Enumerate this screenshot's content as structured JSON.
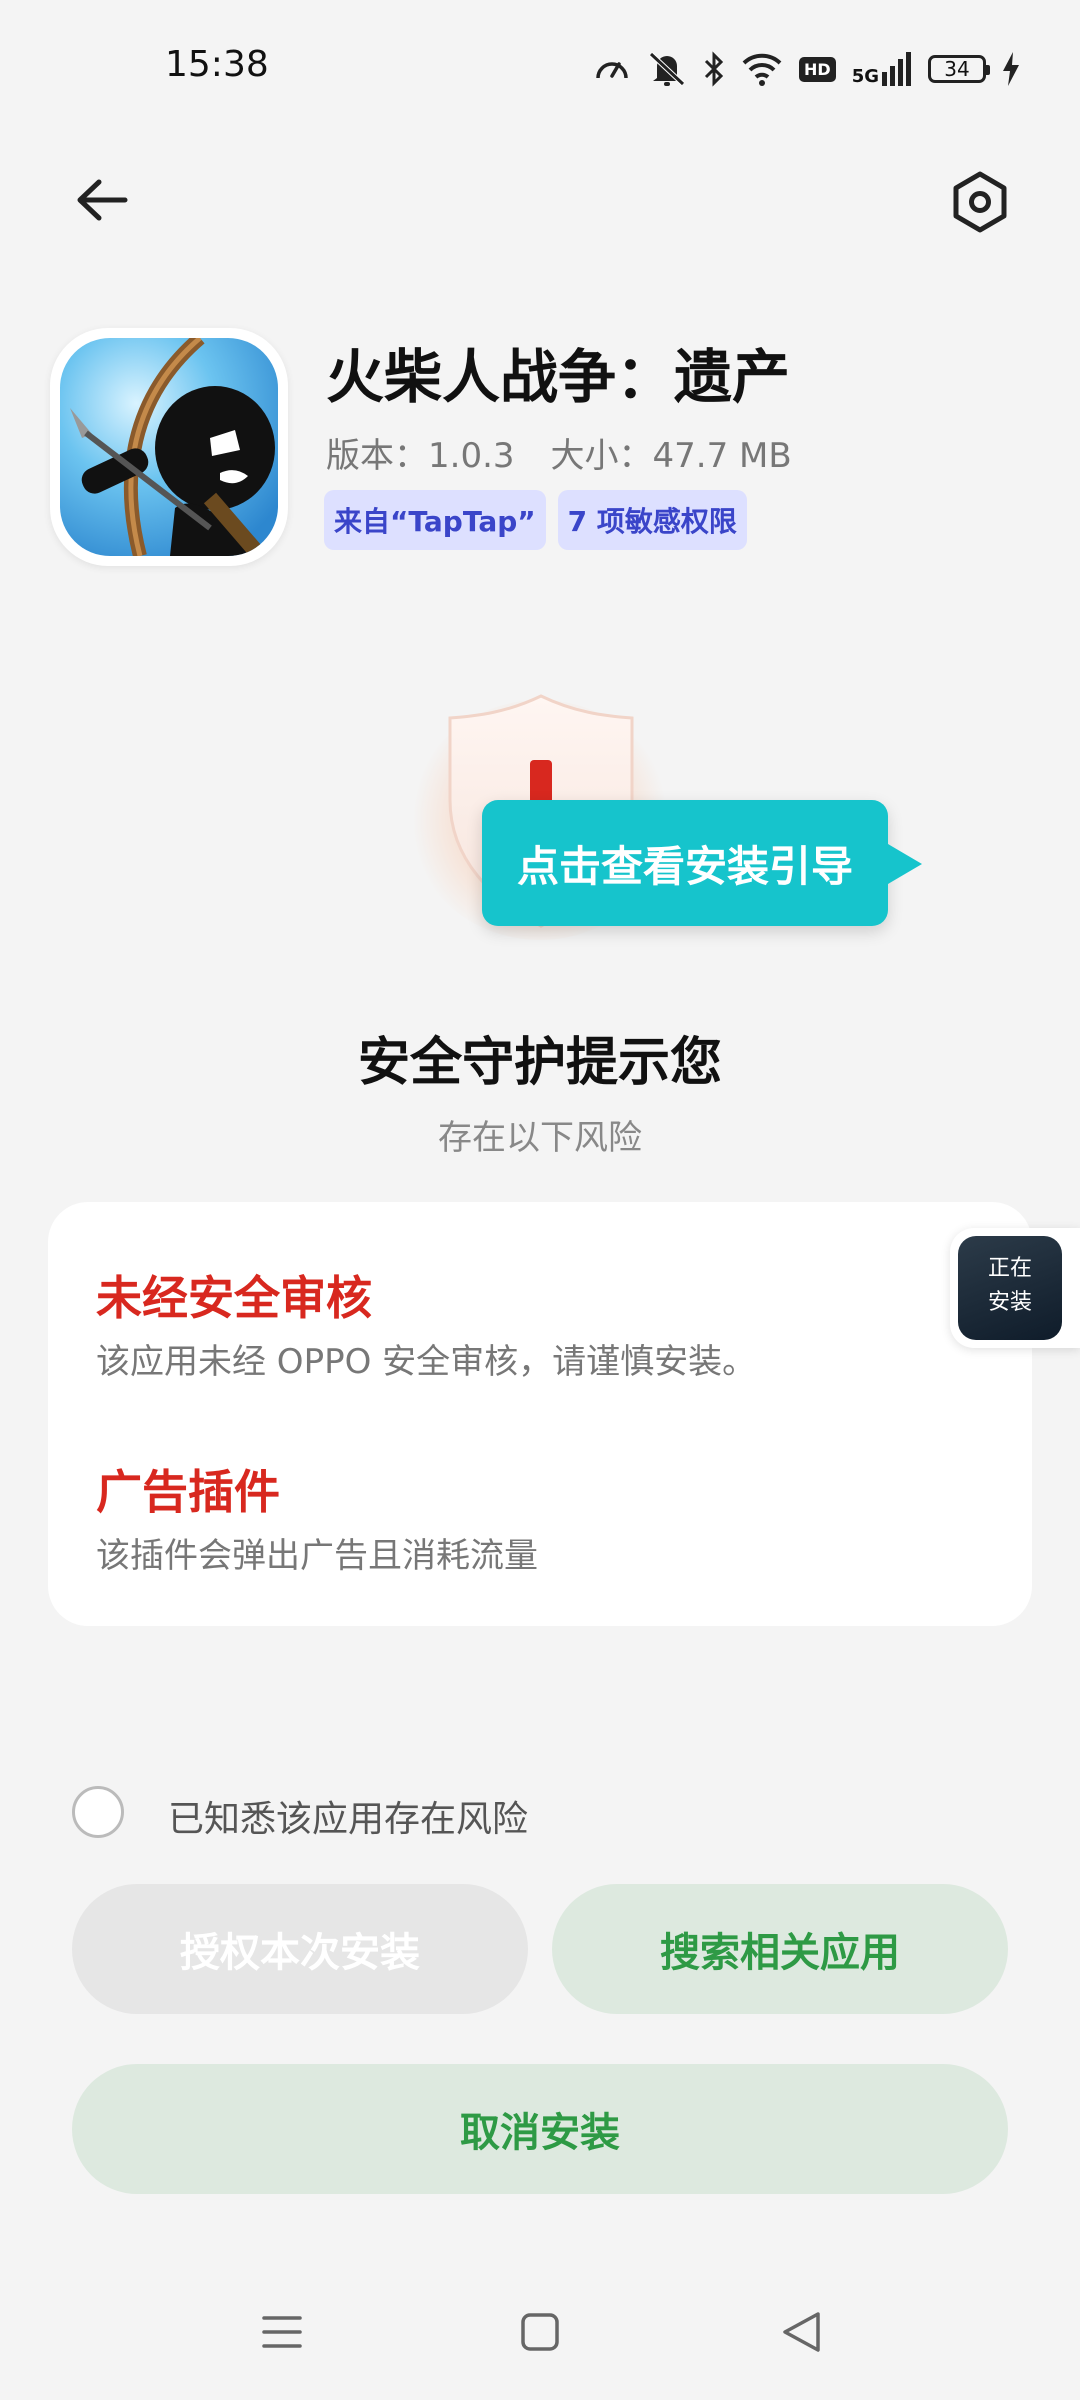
{
  "status_bar": {
    "time": "15:38",
    "network": "5G",
    "hd_badge": "HD",
    "battery": "34",
    "icons": [
      "speed-icon",
      "mute-icon",
      "bluetooth-icon",
      "wifi-icon",
      "hd-icon",
      "signal-icon",
      "battery-icon",
      "charging-icon"
    ]
  },
  "nav": {
    "back_icon": "back-arrow-icon",
    "settings_icon": "settings-icon"
  },
  "app": {
    "name": "火柴人战争：遗产",
    "version": "版本：1.0.3",
    "size": "大小：47.7 MB",
    "tags": [
      "来自“TapTap”",
      "7 项敏感权限"
    ]
  },
  "guide_tooltip": "点击查看安装引导",
  "security": {
    "title": "安全守护提示您",
    "subtitle": "存在以下风险",
    "risks": [
      {
        "title": "未经安全审核",
        "desc": "该应用未经 OPPO 安全审核，请谨慎安装。"
      },
      {
        "title": "广告插件",
        "desc": "该插件会弹出广告且消耗流量"
      }
    ]
  },
  "installing_widget": {
    "line1": "正在",
    "line2": "安装"
  },
  "acknowledge_label": "已知悉该应用存在风险",
  "buttons": {
    "authorize": "授权本次安装",
    "search": "搜索相关应用",
    "cancel": "取消安装"
  },
  "colors": {
    "risk_red": "#d8281f",
    "accent_green": "#2e9a45",
    "tooltip_teal": "#16c4cc",
    "tag_blue": "#3a45c9"
  }
}
